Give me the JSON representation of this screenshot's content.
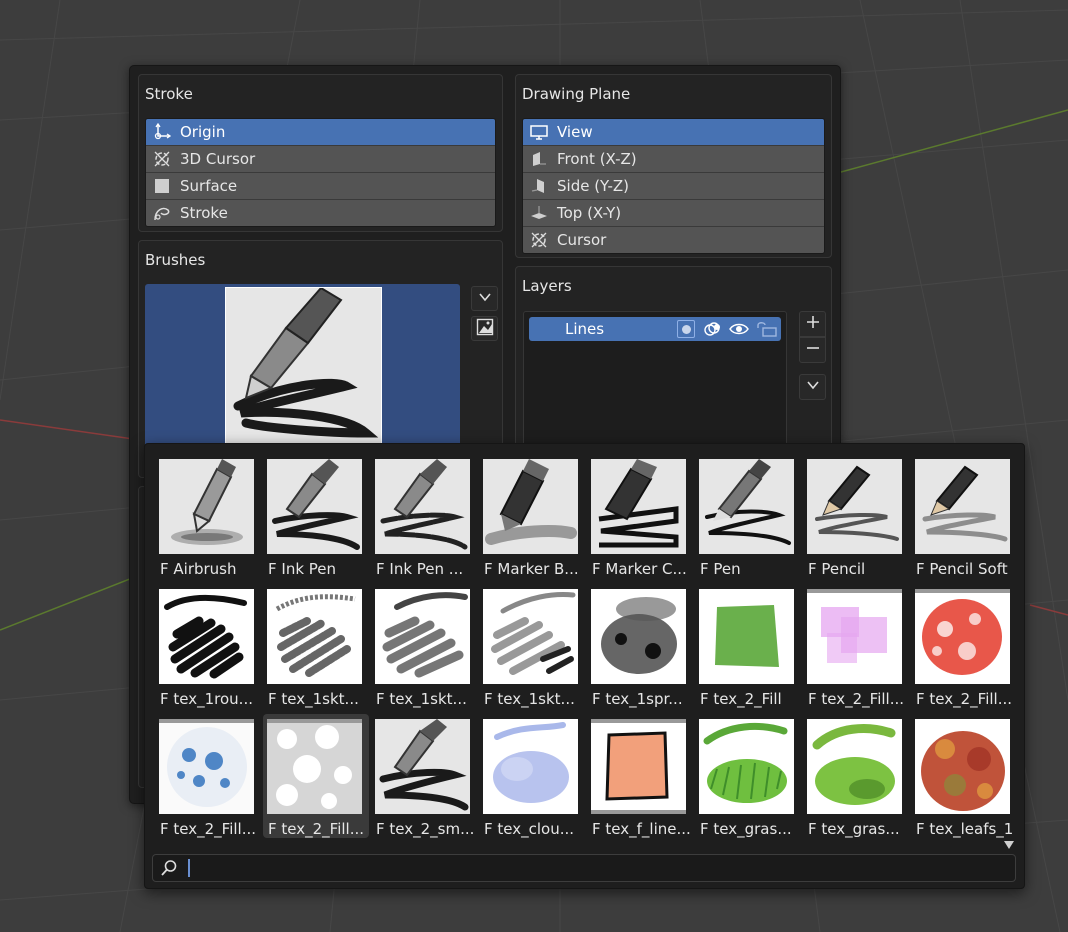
{
  "stroke": {
    "title": "Stroke",
    "items": [
      {
        "label": "Origin",
        "icon": "origin-icon",
        "selected": true
      },
      {
        "label": "3D Cursor",
        "icon": "cursor-3d-icon",
        "selected": false
      },
      {
        "label": "Surface",
        "icon": "surface-icon",
        "selected": false
      },
      {
        "label": "Stroke",
        "icon": "stroke-icon",
        "selected": false
      }
    ]
  },
  "drawing_plane": {
    "title": "Drawing Plane",
    "items": [
      {
        "label": "View",
        "icon": "view-icon",
        "selected": true
      },
      {
        "label": "Front (X-Z)",
        "icon": "front-plane-icon",
        "selected": false
      },
      {
        "label": "Side (Y-Z)",
        "icon": "side-plane-icon",
        "selected": false
      },
      {
        "label": "Top (X-Y)",
        "icon": "top-plane-icon",
        "selected": false
      },
      {
        "label": "Cursor",
        "icon": "cursor-icon",
        "selected": false
      }
    ]
  },
  "brushes": {
    "title": "Brushes"
  },
  "layers": {
    "title": "Layers",
    "items": [
      {
        "label": "Lines"
      }
    ]
  },
  "brush_browser": {
    "items": [
      {
        "label": "F Airbrush"
      },
      {
        "label": "F Ink Pen"
      },
      {
        "label": "F Ink Pen ..."
      },
      {
        "label": "F Marker B..."
      },
      {
        "label": "F Marker C..."
      },
      {
        "label": "F Pen"
      },
      {
        "label": "F Pencil"
      },
      {
        "label": "F Pencil Soft"
      },
      {
        "label": "F tex_1rou..."
      },
      {
        "label": "F tex_1skt..."
      },
      {
        "label": "F tex_1skt..."
      },
      {
        "label": "F tex_1skt..."
      },
      {
        "label": "F tex_1spr..."
      },
      {
        "label": "F tex_2_Fill"
      },
      {
        "label": "F tex_2_Fill..."
      },
      {
        "label": "F tex_2_Fill..."
      },
      {
        "label": "F tex_2_Fill..."
      },
      {
        "label": "F tex_2_Fill..."
      },
      {
        "label": "F tex_2_sm..."
      },
      {
        "label": "F tex_clou..."
      },
      {
        "label": "F tex_f_line..."
      },
      {
        "label": "F tex_gras..."
      },
      {
        "label": "F tex_gras..."
      },
      {
        "label": "F tex_leafs_1"
      }
    ],
    "active_index": 17,
    "search": {
      "value": "",
      "placeholder": ""
    }
  },
  "colors": {
    "accent": "#4772b3",
    "panel_bg": "#1f1f1f",
    "row_bg": "#545454"
  }
}
